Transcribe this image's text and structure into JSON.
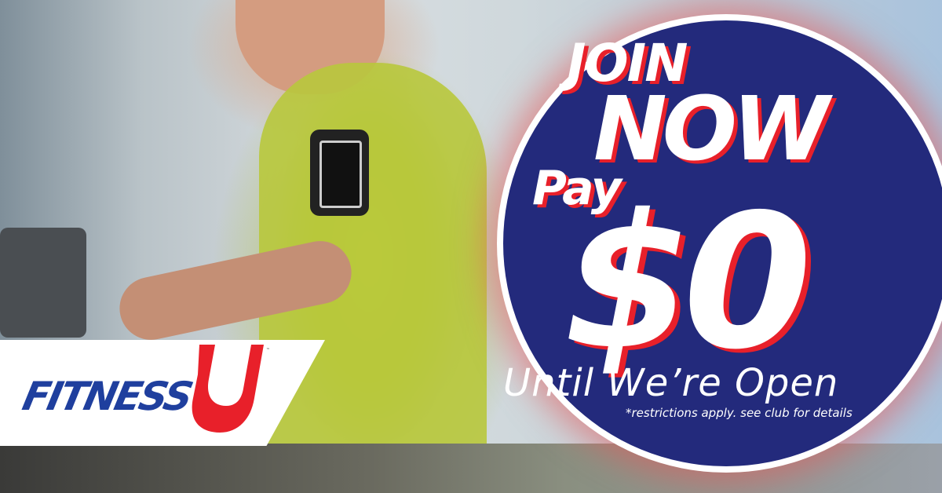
{
  "headline": {
    "join": "JOIN",
    "now": "NOW",
    "pay": "Pay",
    "price": "$0"
  },
  "subheadline": "Until We’re Open",
  "disclaimer": "*restrictions apply. see club for details",
  "logo": {
    "text": "FITNESS",
    "letter": "U",
    "trademark": "™"
  },
  "colors": {
    "navy": "#232a7c",
    "red": "#e8202a",
    "logo_blue": "#1f3f9e",
    "white": "#ffffff"
  }
}
